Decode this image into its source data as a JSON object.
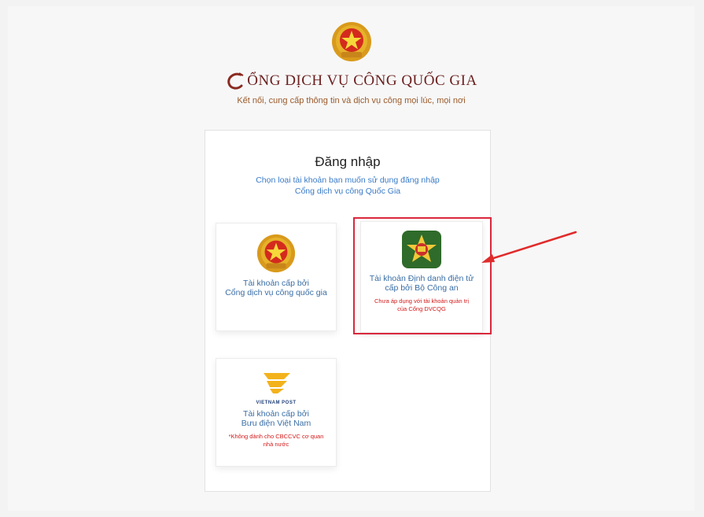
{
  "header": {
    "brand_first_letter": "C",
    "brand_rest": "ỔNG DỊCH VỤ CÔNG QUỐC GIA",
    "tagline": "Kết nối, cung cấp thông tin và dịch vụ công mọi lúc, mọi nơi"
  },
  "login": {
    "title": "Đăng nhập",
    "subtitle_line1": "Chọn loại tài khoản bạn muốn sử dụng đăng nhập",
    "subtitle_line2": "Cổng dịch vụ công Quốc Gia"
  },
  "options": [
    {
      "line1": "Tài khoản cấp bởi",
      "line2": "Cổng dịch vụ công quốc gia",
      "icon": "national-emblem-icon"
    },
    {
      "line1": "Tài khoản Định danh điện tử",
      "line2": "cấp bởi Bộ Công an",
      "note1": "Chưa áp dụng với tài khoản quản trị",
      "note2": "của Cổng DVCQG",
      "icon": "police-badge-icon"
    },
    {
      "line1": "Tài khoản cấp bởi",
      "line2": "Bưu điện Việt Nam",
      "note1": "*Không dành cho CBCCVC cơ quan",
      "note2": "nhà nước",
      "logo_text": "VIETNAM POST",
      "icon": "vietnam-post-logo-icon"
    }
  ],
  "colors": {
    "brand": "#6b1f1f",
    "link": "#3a6ea5",
    "warning": "#d41a1a",
    "highlight": "#d9283c"
  }
}
